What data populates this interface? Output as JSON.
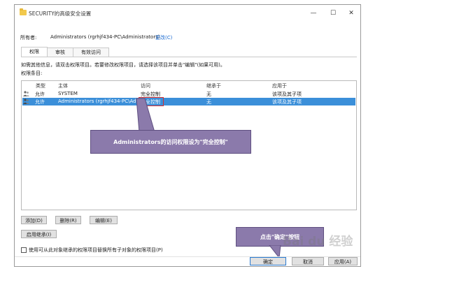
{
  "window": {
    "title": "SECURITY的高级安全设置",
    "controls": {
      "minimize": "—",
      "maximize": "☐",
      "close": "✕"
    }
  },
  "owner": {
    "label": "所有者:",
    "value": "Administrators (rgrhjf434-PC\\Administrators)",
    "change_link": "更改(C)"
  },
  "tabs": [
    {
      "label": "权限",
      "active": true
    },
    {
      "label": "审核",
      "active": false
    },
    {
      "label": "有效访问",
      "active": false
    }
  ],
  "info_text": "如需其他信息，请双击权限项目。若要修改权限项目，请选择该项目并单击\"编辑\"(如果可用)。",
  "entries_label": "权限条目:",
  "columns": [
    "类型",
    "主体",
    "访问",
    "继承于",
    "应用于"
  ],
  "rows": [
    {
      "type": "允许",
      "principal": "SYSTEM",
      "access": "完全控制",
      "inherited": "无",
      "applies": "该项及其子项",
      "selected": false
    },
    {
      "type": "允许",
      "principal": "Administrators (rgrhjf434-PC\\Ad...",
      "access": "完全控制",
      "inherited": "无",
      "applies": "该项及其子项",
      "selected": true
    }
  ],
  "callout_main": "Administrators的访问权限设为\"完全控制\"",
  "callout_ok": "点击\"确定\"按钮",
  "buttons": {
    "add": "添加(D)",
    "remove": "删除(R)",
    "edit": "编辑(E)",
    "enable_inheritance": "启用继承(I)",
    "ok": "确定",
    "cancel": "取消",
    "apply": "应用(A)"
  },
  "replace_checkbox_label": "使用可从此对象继承的权限项目替换所有子对象的权限项目(P)",
  "watermark": "Bai du 经验",
  "colors": {
    "selection": "#3b8fd9",
    "callout": "#8b7aab",
    "highlight_box": "#d62e2e",
    "link": "#1a6ad1"
  }
}
